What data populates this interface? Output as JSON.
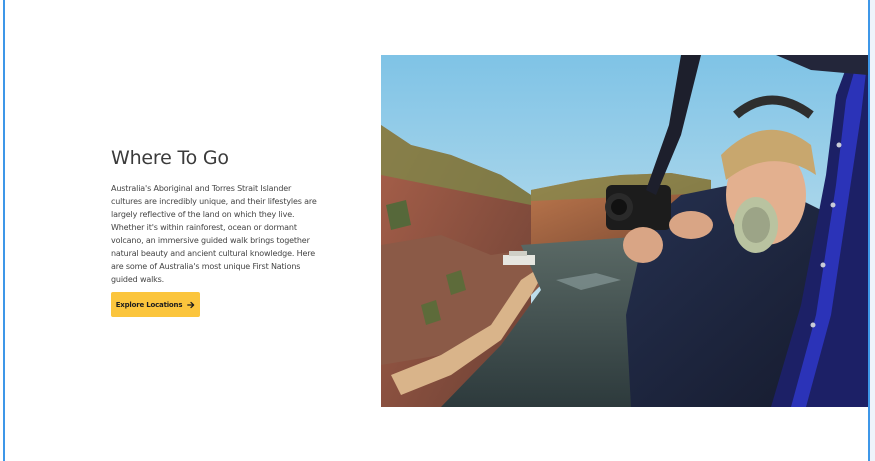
{
  "section": {
    "heading": "Where To Go",
    "body": "Australia's Aboriginal and Torres Strait Islander cultures are incredibly unique, and their lifestyles are largely reflective of the land on which they live. Whether it's within rainforest, ocean or dormant volcano, an immersive guided walk brings together natural beauty and ancient cultural knowledge. Here are some of Australia's most unique First Nations guided walks.",
    "cta_label": "Explore Locations",
    "cta_icon": "arrow-right-icon"
  },
  "photo": {
    "subject": "photographer-in-helicopter-over-gorge"
  },
  "colors": {
    "cta_background": "#fbc53d",
    "heading": "#3b3b3b",
    "body_text": "#444444",
    "frame_edge": "#3d97e8"
  }
}
